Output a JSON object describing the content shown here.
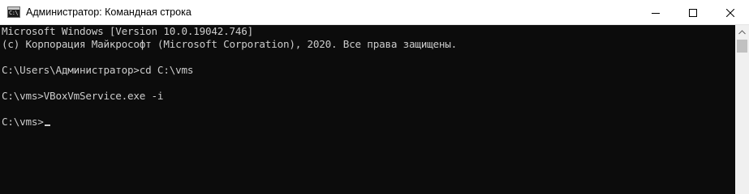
{
  "window": {
    "title": "Администратор: Командная строка",
    "icon_glyph": "C:\\",
    "controls": {
      "minimize": "minimize-icon",
      "maximize": "maximize-icon",
      "close": "close-icon"
    }
  },
  "console": {
    "lines": [
      "Microsoft Windows [Version 10.0.19042.746]",
      "(c) Корпорация Майкрософт (Microsoft Corporation), 2020. Все права защищены.",
      "C:\\Users\\Администратор>cd C:\\vms",
      "C:\\vms>VBoxVmService.exe -i",
      "C:\\vms>"
    ]
  },
  "colors": {
    "console_background": "#0c0c0c",
    "console_text": "#cccccc",
    "titlebar_background": "#ffffff"
  }
}
